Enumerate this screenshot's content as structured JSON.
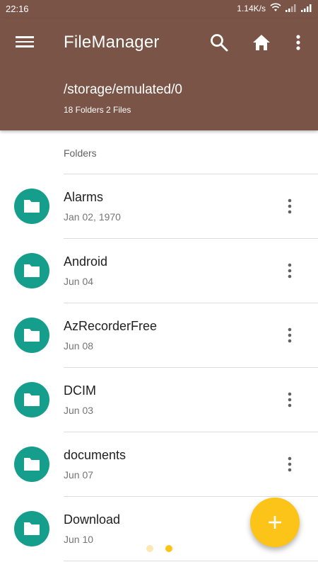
{
  "status_bar": {
    "time": "22:16",
    "network_speed": "1.14K/s",
    "icons": [
      "wifi-icon",
      "signal-icon",
      "signal-icon"
    ]
  },
  "app_bar": {
    "title": "FileManager",
    "path": "/storage/emulated/0",
    "summary": "18 Folders 2 Files",
    "icons": [
      "menu-icon",
      "search-icon",
      "home-icon",
      "more-vert-icon"
    ]
  },
  "section": {
    "label": "Folders"
  },
  "folders": [
    {
      "name": "Alarms",
      "date": "Jan 02, 1970"
    },
    {
      "name": "Android",
      "date": "Jun 04"
    },
    {
      "name": "AzRecorderFree",
      "date": "Jun 08"
    },
    {
      "name": "DCIM",
      "date": "Jun 03"
    },
    {
      "name": "documents",
      "date": "Jun 07"
    },
    {
      "name": "Download",
      "date": "Jun 10"
    }
  ],
  "fab": {
    "icon": "plus-icon"
  },
  "page_indicator": {
    "count": 2,
    "active": 1
  },
  "colors": {
    "app_bar": "#7a5446",
    "folder_icon": "#159e8b",
    "fab": "#fcc419",
    "indicator_active": "#fcc419",
    "indicator_inactive": "#fde7b3"
  }
}
